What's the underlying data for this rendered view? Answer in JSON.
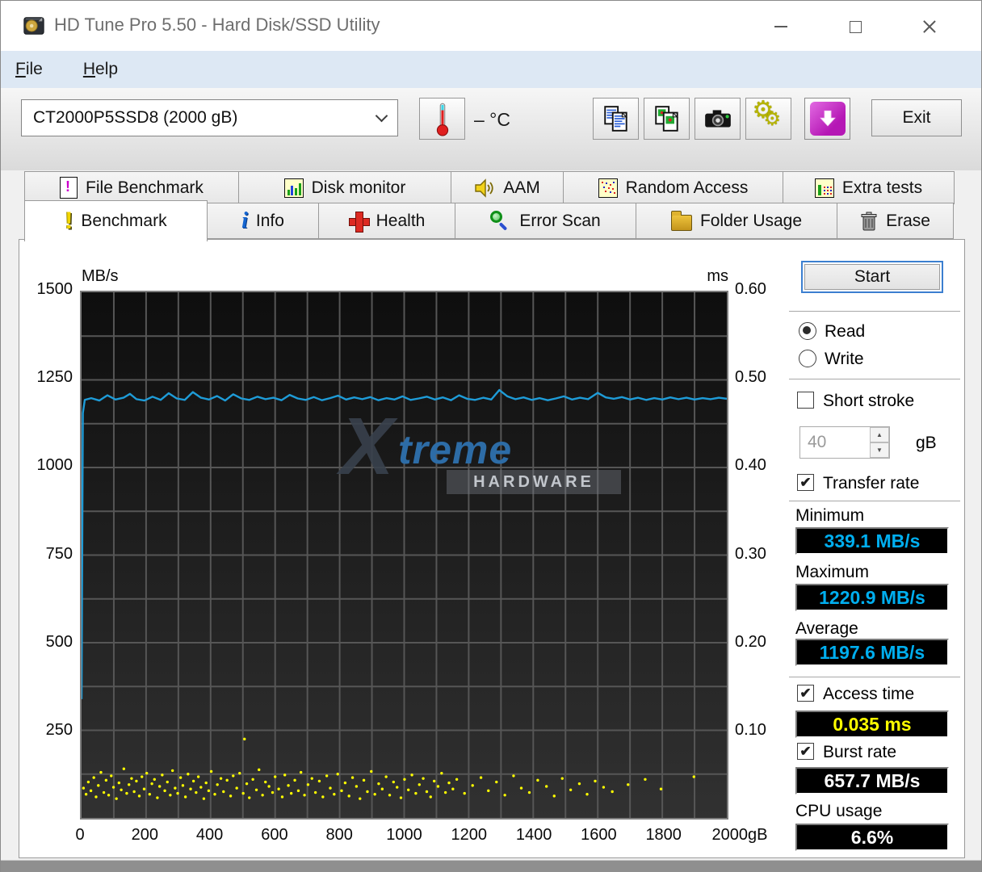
{
  "window": {
    "title": "HD Tune Pro 5.50 - Hard Disk/SSD Utility"
  },
  "menu": {
    "items": [
      {
        "label": "File"
      },
      {
        "label": "Help"
      }
    ]
  },
  "toolbar": {
    "drive_select": "CT2000P5SSD8 (2000 gB)",
    "temperature": "– °C",
    "exit_label": "Exit",
    "buttons": [
      {
        "name": "copy-text"
      },
      {
        "name": "copy-image"
      },
      {
        "name": "screenshot"
      },
      {
        "name": "settings"
      },
      {
        "name": "save-download"
      }
    ]
  },
  "tabs": {
    "row1": [
      {
        "label": "File Benchmark"
      },
      {
        "label": "Disk monitor"
      },
      {
        "label": "AAM"
      },
      {
        "label": "Random Access"
      },
      {
        "label": "Extra tests"
      }
    ],
    "row2": [
      {
        "label": "Benchmark",
        "active": true
      },
      {
        "label": "Info"
      },
      {
        "label": "Health"
      },
      {
        "label": "Error Scan"
      },
      {
        "label": "Folder Usage"
      },
      {
        "label": "Erase"
      }
    ]
  },
  "controls": {
    "start_label": "Start",
    "read_label": "Read",
    "write_label": "Write",
    "short_stroke_label": "Short stroke",
    "short_stroke_value": "40",
    "short_stroke_unit": "gB",
    "transfer_rate_label": "Transfer rate",
    "minimum_label": "Minimum",
    "minimum_value": "339.1 MB/s",
    "maximum_label": "Maximum",
    "maximum_value": "1220.9 MB/s",
    "average_label": "Average",
    "average_value": "1197.6 MB/s",
    "access_time_label": "Access time",
    "access_time_value": "0.035 ms",
    "burst_rate_label": "Burst rate",
    "burst_rate_value": "657.7 MB/s",
    "cpu_usage_label": "CPU usage",
    "cpu_usage_value": "6.6%"
  },
  "watermark": {
    "x": "X",
    "text": "treme",
    "sub": "HARDWARE"
  },
  "chart_data": {
    "type": "line",
    "title": "",
    "x_axis": {
      "min": 0,
      "max": 2000,
      "ticks": [
        0,
        200,
        400,
        600,
        800,
        1000,
        1200,
        1400,
        1600,
        1800,
        2000
      ],
      "suffix": "gB"
    },
    "y_left": {
      "label": "MB/s",
      "min": 0,
      "max": 1500,
      "ticks": [
        1500,
        1250,
        1000,
        750,
        500,
        250
      ]
    },
    "y_right": {
      "label": "ms",
      "min": 0,
      "max": 0.6,
      "ticks": [
        "0.60",
        "0.50",
        "0.40",
        "0.30",
        "0.20",
        "0.10"
      ]
    },
    "grid": {
      "x_step": 100,
      "y_left_step": 125,
      "color": "#565656"
    },
    "legend": "none",
    "series": [
      {
        "name": "transfer-rate",
        "type": "line",
        "axis": "left",
        "unit": "MB/s",
        "color": "#1e9cd8",
        "stats": {
          "minimum": 339.1,
          "maximum": 1220.9,
          "average": 1197.6
        },
        "points": [
          [
            0,
            339
          ],
          [
            4,
            1155
          ],
          [
            10,
            1193
          ],
          [
            30,
            1198
          ],
          [
            55,
            1191
          ],
          [
            80,
            1206
          ],
          [
            105,
            1194
          ],
          [
            130,
            1199
          ],
          [
            150,
            1210
          ],
          [
            170,
            1195
          ],
          [
            195,
            1191
          ],
          [
            220,
            1202
          ],
          [
            245,
            1193
          ],
          [
            270,
            1212
          ],
          [
            295,
            1197
          ],
          [
            320,
            1193
          ],
          [
            345,
            1215
          ],
          [
            370,
            1199
          ],
          [
            395,
            1194
          ],
          [
            420,
            1204
          ],
          [
            445,
            1191
          ],
          [
            470,
            1209
          ],
          [
            495,
            1197
          ],
          [
            520,
            1193
          ],
          [
            545,
            1202
          ],
          [
            570,
            1195
          ],
          [
            595,
            1199
          ],
          [
            620,
            1192
          ],
          [
            645,
            1207
          ],
          [
            670,
            1197
          ],
          [
            695,
            1193
          ],
          [
            720,
            1201
          ],
          [
            745,
            1192
          ],
          [
            770,
            1198
          ],
          [
            795,
            1205
          ],
          [
            820,
            1194
          ],
          [
            845,
            1200
          ],
          [
            870,
            1195
          ],
          [
            895,
            1201
          ],
          [
            920,
            1192
          ],
          [
            945,
            1198
          ],
          [
            970,
            1194
          ],
          [
            995,
            1203
          ],
          [
            1020,
            1193
          ],
          [
            1045,
            1197
          ],
          [
            1070,
            1202
          ],
          [
            1095,
            1194
          ],
          [
            1120,
            1200
          ],
          [
            1145,
            1192
          ],
          [
            1170,
            1206
          ],
          [
            1195,
            1196
          ],
          [
            1220,
            1193
          ],
          [
            1245,
            1199
          ],
          [
            1270,
            1194
          ],
          [
            1295,
            1221
          ],
          [
            1320,
            1203
          ],
          [
            1345,
            1195
          ],
          [
            1370,
            1200
          ],
          [
            1395,
            1193
          ],
          [
            1420,
            1198
          ],
          [
            1445,
            1192
          ],
          [
            1470,
            1197
          ],
          [
            1495,
            1203
          ],
          [
            1520,
            1194
          ],
          [
            1545,
            1199
          ],
          [
            1570,
            1195
          ],
          [
            1600,
            1213
          ],
          [
            1625,
            1200
          ],
          [
            1650,
            1196
          ],
          [
            1675,
            1201
          ],
          [
            1700,
            1194
          ],
          [
            1725,
            1199
          ],
          [
            1750,
            1193
          ],
          [
            1775,
            1198
          ],
          [
            1800,
            1194
          ],
          [
            1825,
            1200
          ],
          [
            1850,
            1195
          ],
          [
            1875,
            1199
          ],
          [
            1900,
            1194
          ],
          [
            1925,
            1198
          ],
          [
            1950,
            1195
          ],
          [
            1975,
            1199
          ],
          [
            2000,
            1196
          ]
        ]
      },
      {
        "name": "access-time",
        "type": "scatter",
        "axis": "right",
        "unit": "ms",
        "color": "#ffff00",
        "stats": {
          "average": 0.035
        },
        "points": [
          [
            6,
            0.034
          ],
          [
            14,
            0.027
          ],
          [
            21,
            0.041
          ],
          [
            29,
            0.031
          ],
          [
            38,
            0.046
          ],
          [
            45,
            0.024
          ],
          [
            52,
            0.037
          ],
          [
            60,
            0.052
          ],
          [
            69,
            0.029
          ],
          [
            76,
            0.043
          ],
          [
            84,
            0.026
          ],
          [
            92,
            0.048
          ],
          [
            99,
            0.035
          ],
          [
            108,
            0.022
          ],
          [
            116,
            0.04
          ],
          [
            123,
            0.032
          ],
          [
            131,
            0.056
          ],
          [
            140,
            0.028
          ],
          [
            147,
            0.038
          ],
          [
            155,
            0.045
          ],
          [
            163,
            0.03
          ],
          [
            170,
            0.042
          ],
          [
            179,
            0.025
          ],
          [
            187,
            0.047
          ],
          [
            194,
            0.033
          ],
          [
            202,
            0.051
          ],
          [
            211,
            0.027
          ],
          [
            218,
            0.039
          ],
          [
            226,
            0.044
          ],
          [
            235,
            0.023
          ],
          [
            242,
            0.036
          ],
          [
            250,
            0.049
          ],
          [
            258,
            0.031
          ],
          [
            266,
            0.041
          ],
          [
            275,
            0.026
          ],
          [
            282,
            0.054
          ],
          [
            290,
            0.034
          ],
          [
            298,
            0.028
          ],
          [
            307,
            0.046
          ],
          [
            314,
            0.037
          ],
          [
            322,
            0.024
          ],
          [
            330,
            0.05
          ],
          [
            338,
            0.033
          ],
          [
            347,
            0.042
          ],
          [
            355,
            0.029
          ],
          [
            362,
            0.047
          ],
          [
            370,
            0.035
          ],
          [
            379,
            0.022
          ],
          [
            386,
            0.04
          ],
          [
            394,
            0.031
          ],
          [
            402,
            0.053
          ],
          [
            413,
            0.027
          ],
          [
            421,
            0.038
          ],
          [
            432,
            0.045
          ],
          [
            440,
            0.03
          ],
          [
            451,
            0.043
          ],
          [
            462,
            0.025
          ],
          [
            470,
            0.048
          ],
          [
            481,
            0.034
          ],
          [
            490,
            0.051
          ],
          [
            501,
            0.028
          ],
          [
            505,
            0.09
          ],
          [
            512,
            0.039
          ],
          [
            520,
            0.023
          ],
          [
            531,
            0.044
          ],
          [
            542,
            0.032
          ],
          [
            550,
            0.055
          ],
          [
            561,
            0.026
          ],
          [
            570,
            0.041
          ],
          [
            581,
            0.036
          ],
          [
            592,
            0.029
          ],
          [
            600,
            0.047
          ],
          [
            611,
            0.033
          ],
          [
            622,
            0.024
          ],
          [
            630,
            0.049
          ],
          [
            641,
            0.037
          ],
          [
            650,
            0.028
          ],
          [
            661,
            0.043
          ],
          [
            672,
            0.031
          ],
          [
            680,
            0.052
          ],
          [
            691,
            0.026
          ],
          [
            702,
            0.038
          ],
          [
            714,
            0.045
          ],
          [
            725,
            0.029
          ],
          [
            737,
            0.042
          ],
          [
            748,
            0.024
          ],
          [
            760,
            0.048
          ],
          [
            771,
            0.034
          ],
          [
            783,
            0.027
          ],
          [
            794,
            0.05
          ],
          [
            806,
            0.031
          ],
          [
            817,
            0.04
          ],
          [
            829,
            0.025
          ],
          [
            840,
            0.046
          ],
          [
            852,
            0.036
          ],
          [
            863,
            0.022
          ],
          [
            875,
            0.043
          ],
          [
            886,
            0.03
          ],
          [
            898,
            0.053
          ],
          [
            909,
            0.027
          ],
          [
            921,
            0.039
          ],
          [
            932,
            0.033
          ],
          [
            944,
            0.047
          ],
          [
            955,
            0.026
          ],
          [
            967,
            0.041
          ],
          [
            978,
            0.035
          ],
          [
            990,
            0.023
          ],
          [
            1001,
            0.044
          ],
          [
            1013,
            0.032
          ],
          [
            1024,
            0.049
          ],
          [
            1036,
            0.028
          ],
          [
            1047,
            0.038
          ],
          [
            1059,
            0.045
          ],
          [
            1070,
            0.03
          ],
          [
            1082,
            0.024
          ],
          [
            1093,
            0.042
          ],
          [
            1105,
            0.036
          ],
          [
            1116,
            0.051
          ],
          [
            1128,
            0.029
          ],
          [
            1139,
            0.04
          ],
          [
            1151,
            0.033
          ],
          [
            1163,
            0.044
          ],
          [
            1187,
            0.028
          ],
          [
            1212,
            0.037
          ],
          [
            1238,
            0.046
          ],
          [
            1261,
            0.031
          ],
          [
            1286,
            0.041
          ],
          [
            1312,
            0.026
          ],
          [
            1339,
            0.048
          ],
          [
            1363,
            0.034
          ],
          [
            1388,
            0.029
          ],
          [
            1414,
            0.043
          ],
          [
            1441,
            0.036
          ],
          [
            1465,
            0.025
          ],
          [
            1490,
            0.045
          ],
          [
            1516,
            0.032
          ],
          [
            1543,
            0.039
          ],
          [
            1567,
            0.027
          ],
          [
            1592,
            0.042
          ],
          [
            1618,
            0.035
          ],
          [
            1645,
            0.03
          ],
          [
            1694,
            0.038
          ],
          [
            1747,
            0.044
          ],
          [
            1796,
            0.033
          ],
          [
            1898,
            0.047
          ]
        ]
      }
    ]
  }
}
